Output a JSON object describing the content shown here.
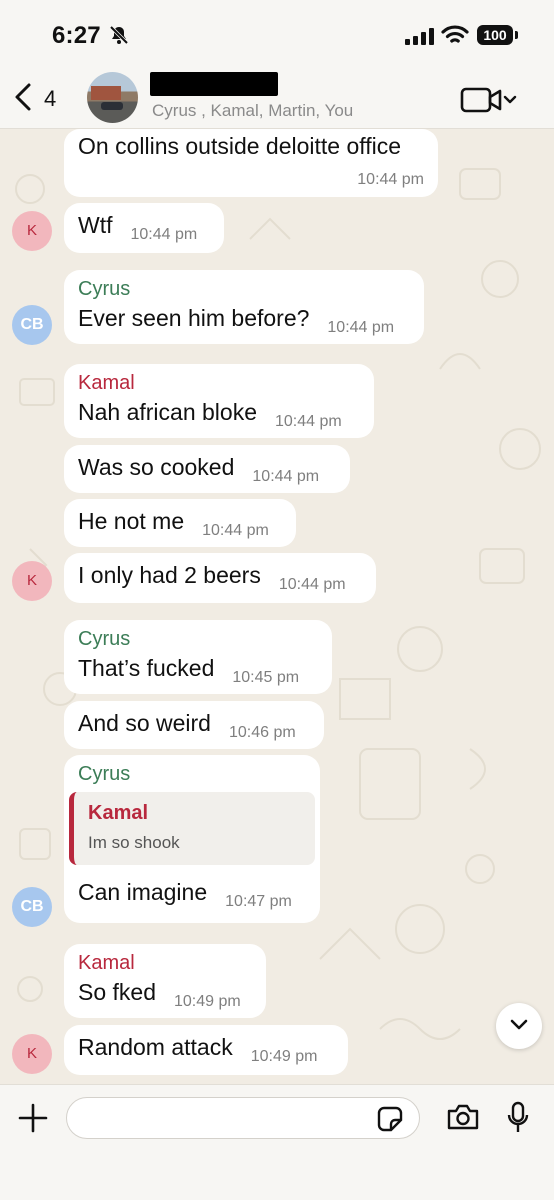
{
  "status_bar": {
    "time": "6:27",
    "battery": "100"
  },
  "header": {
    "back_count": "4",
    "members": "Cyrus , Kamal, Martin, You"
  },
  "messages": [
    {
      "text": "On collins outside deloitte office",
      "time": "10:44 pm"
    },
    {
      "avatar": "K",
      "text": "Wtf",
      "time": "10:44 pm"
    },
    {
      "sender": "Cyrus",
      "avatar": "CB",
      "text": "Ever seen him before?",
      "time": "10:44 pm"
    },
    {
      "sender": "Kamal",
      "text": "Nah african bloke",
      "time": "10:44 pm"
    },
    {
      "text": "Was so cooked",
      "time": "10:44 pm"
    },
    {
      "text": "He not me",
      "time": "10:44 pm"
    },
    {
      "avatar": "K",
      "text": "I only had 2 beers",
      "time": "10:44 pm"
    },
    {
      "sender": "Cyrus",
      "text": "That’s fucked",
      "time": "10:45 pm"
    },
    {
      "text": "And so weird",
      "time": "10:46 pm"
    },
    {
      "sender": "Cyrus",
      "avatar": "CB",
      "quote_sender": "Kamal",
      "quote_text": "Im so shook",
      "text": "Can imagine",
      "time": "10:47 pm"
    },
    {
      "sender": "Kamal",
      "text": "So fked",
      "time": "10:49 pm"
    },
    {
      "avatar": "K",
      "text": "Random attack",
      "time": "10:49 pm"
    }
  ],
  "composer": {
    "placeholder": ""
  },
  "colors": {
    "wallpaper": "#f1ece3",
    "bubble": "#ffffff",
    "sender_cyrus": "#3c7d57",
    "sender_kamal": "#b8283d",
    "avatar_k_bg": "#f2b7bd",
    "avatar_cb_bg": "#a7c7ee"
  },
  "icons": [
    "bell-slash-icon",
    "signal-icon",
    "wifi-icon",
    "battery-icon",
    "back-chevron-icon",
    "video-call-icon",
    "chevron-down-icon",
    "plus-icon",
    "sticker-icon",
    "camera-icon",
    "microphone-icon"
  ]
}
